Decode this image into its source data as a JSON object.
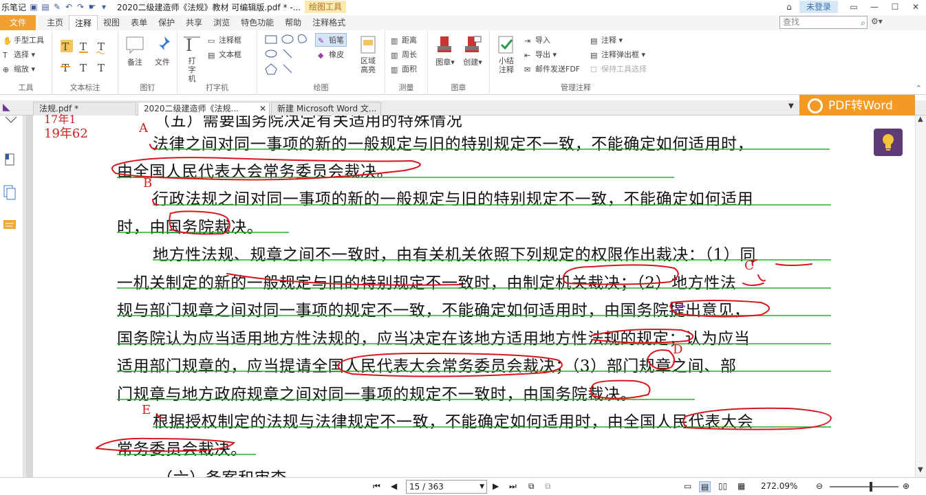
{
  "app": {
    "name": "乐笔记",
    "doc_title": "2020二级建造师《法规》教材 可编辑版.pdf * -...",
    "context_tab": "绘图工具",
    "login": "未登录"
  },
  "menu": {
    "file": "文件",
    "tabs": [
      "主页",
      "注释",
      "视图",
      "表单",
      "保护",
      "共享",
      "浏览",
      "特色功能",
      "帮助",
      "注释格式"
    ],
    "active_tab": "注释",
    "search_placeholder": "查找"
  },
  "ribbon": {
    "tools": {
      "items": [
        "手型工具",
        "选择",
        "缩放"
      ],
      "label": "工具"
    },
    "text_markup": {
      "label": "文本标注"
    },
    "pin": {
      "items": [
        "备注",
        "文件"
      ],
      "label": "图钉"
    },
    "typewriter": {
      "big": "打字机",
      "items": [
        "注释框",
        "文本框"
      ],
      "label": "打字机"
    },
    "drawing": {
      "items": [
        "铅笔",
        "橡皮"
      ],
      "label": "绘图"
    },
    "area_highlight": {
      "label": "区域高亮"
    },
    "measure": {
      "items": [
        "距离",
        "周长",
        "面积"
      ],
      "label": "测量"
    },
    "stamp": {
      "items": [
        "图章",
        "创建"
      ],
      "label": "图章"
    },
    "manage": {
      "summary": "小结注释",
      "items": [
        "导入",
        "导出",
        "邮件发送FDF",
        "注释",
        "注释弹出框",
        "保持工具选择"
      ],
      "label": "管理注释"
    }
  },
  "doc_tabs": [
    {
      "label": "法规.pdf *"
    },
    {
      "label": "2020二级建造师《法规..."
    },
    {
      "label": "新建 Microsoft Word 文..."
    }
  ],
  "pdf2word": "PDF转Word",
  "margin_notes": {
    "top1": "17年1",
    "top2": "19年62",
    "A": "A",
    "B": "B",
    "C": "C",
    "D": "D",
    "E": "E"
  },
  "document_lines": [
    "（五）需要国务院决定有关适用的特殊情况",
    "法律之间对同一事项的新的一般规定与旧的特别规定不一致，不能确定如何适用时，",
    "由全国人民代表大会常务委员会裁决。",
    "行政法规之间对同一事项的新的一般规定与旧的特别规定不一致，不能确定如何适用",
    "时，由国务院裁决。",
    "地方性法规、规章之间不一致时，由有关机关依照下列规定的权限作出裁决：（1）同",
    "一机关制定的新的一般规定与旧的特别规定不一致时，由制定机关裁决；（2）地方性法",
    "规与部门规章之间对同一事项的规定不一致，不能确定如何适用时，由国务院提出意见，",
    "国务院认为应当适用地方性法规的，应当决定在该地方适用地方性法规的规定；认为应当",
    "适用部门规章的，应当提请全国人民代表大会常务委员会裁决；（3）部门规章之间、部",
    "门规章与地方政府规章之间对同一事项的规定不一致时，由国务院裁决。",
    "根据授权制定的法规与法律规定不一致，不能确定如何适用时，由全国人民代表大会",
    "常务委员会裁决。",
    "（六）备案和审查"
  ],
  "status": {
    "page": "15 / 363",
    "zoom": "272.09%",
    "zoom_fraction": 0.6
  },
  "colors": {
    "file_tab": "#f0a030",
    "pdf2word": "#f39a25",
    "ink_red": "#d8141c",
    "underline_green": "#2aa82a",
    "bulb_bg": "#5d3b74"
  }
}
